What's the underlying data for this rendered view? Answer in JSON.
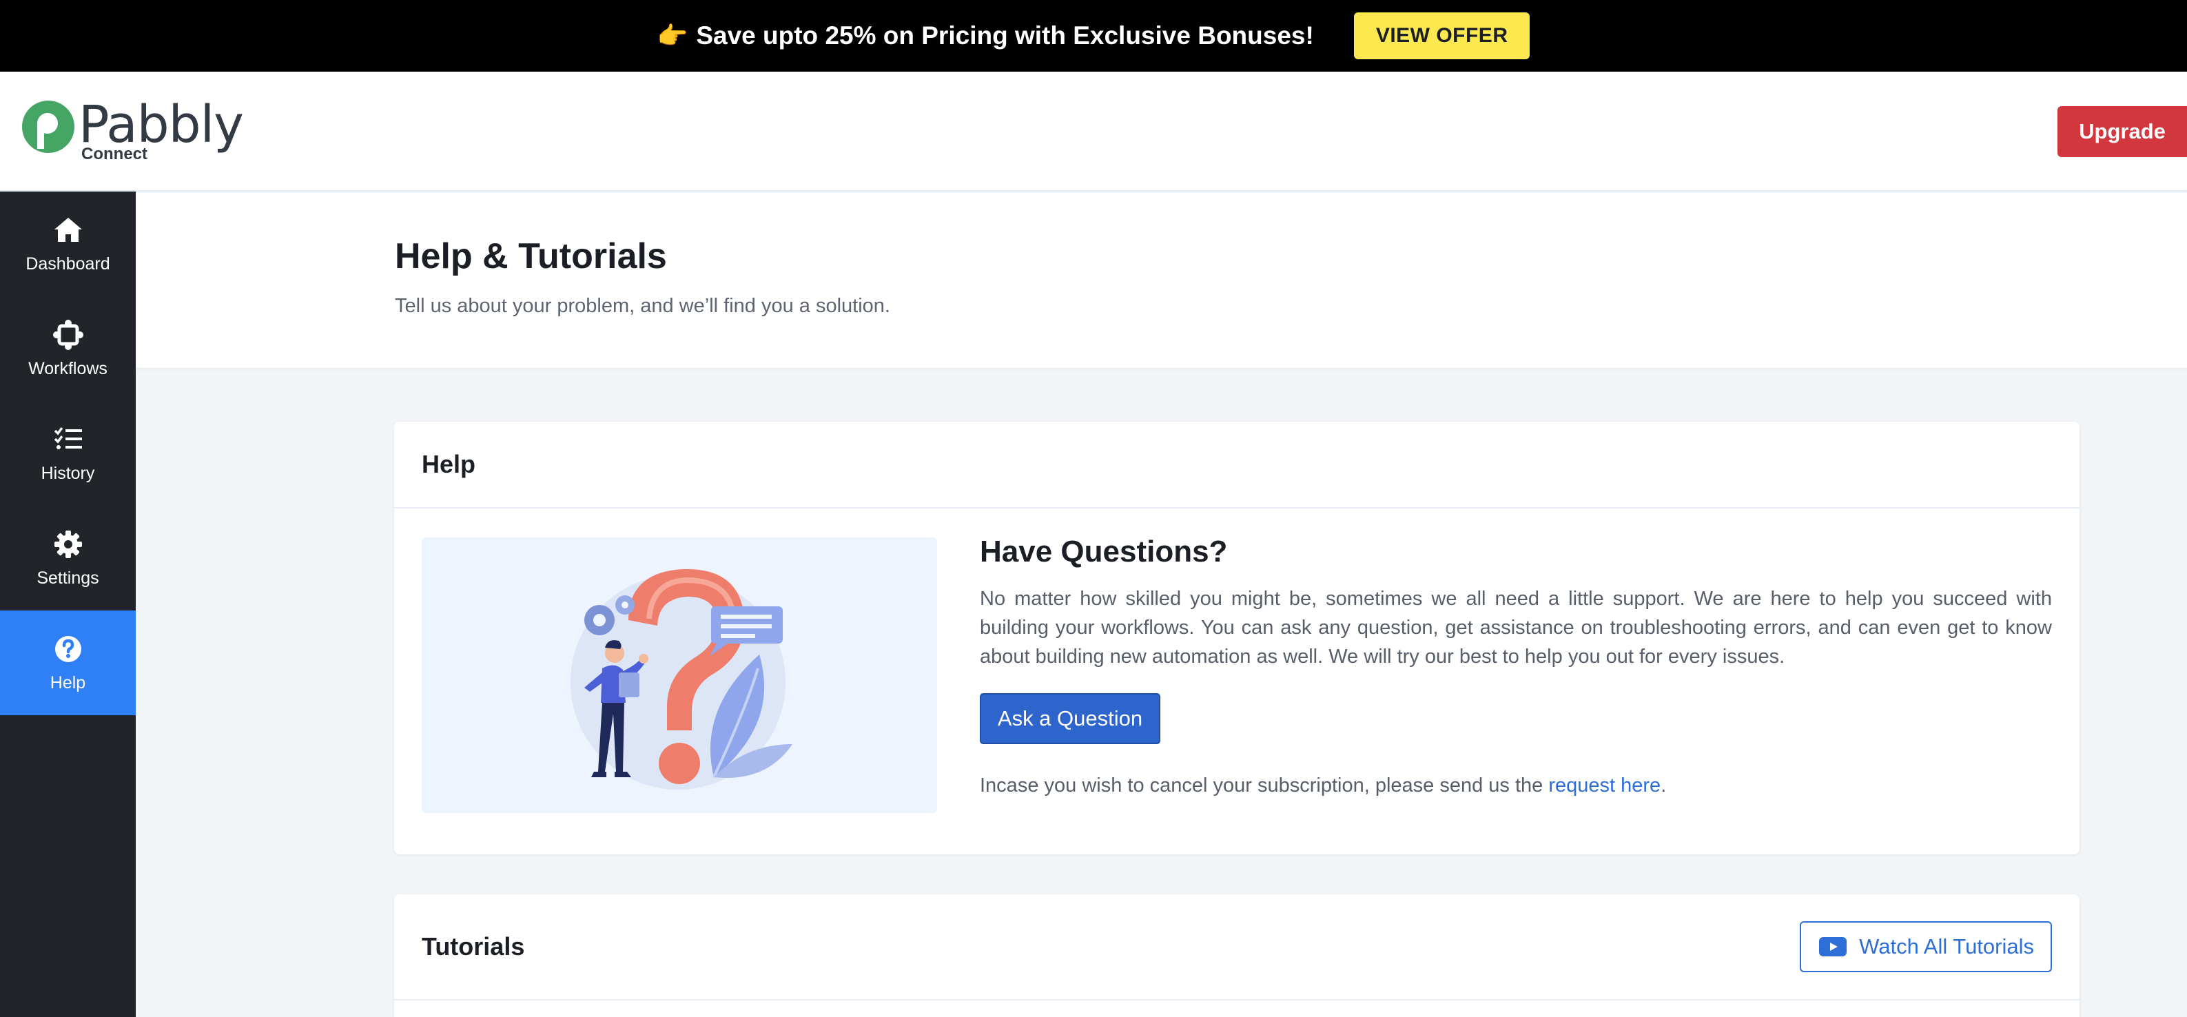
{
  "promo": {
    "emoji": "👉",
    "text": "Save upto 25% on Pricing with Exclusive Bonuses!",
    "button": "VIEW OFFER"
  },
  "header": {
    "logo_word": "Pabbly",
    "logo_sub": "Connect",
    "upgrade": "Upgrade"
  },
  "sidebar": {
    "items": [
      {
        "label": "Dashboard",
        "icon": "home-icon"
      },
      {
        "label": "Workflows",
        "icon": "workflow-icon"
      },
      {
        "label": "History",
        "icon": "checklist-icon"
      },
      {
        "label": "Settings",
        "icon": "gear-icon"
      },
      {
        "label": "Help",
        "icon": "question-circle-icon",
        "active": true
      }
    ]
  },
  "page": {
    "title": "Help & Tutorials",
    "subtitle": "Tell us about your problem, and we’ll find you a solution."
  },
  "help_card": {
    "heading": "Help",
    "title": "Have Questions?",
    "body": "No matter how skilled you might be, sometimes we all need a little support. We are here to help you succeed with building your workflows. You can ask any question, get assistance on troubleshooting errors, and can even get to know about building new automation as well. We will try our best to help you out for every issues.",
    "ask_button": "Ask a Question",
    "cancel_text": "Incase you wish to cancel your subscription, please send us the ",
    "cancel_link": "request here",
    "cancel_end": "."
  },
  "tutorials_card": {
    "heading": "Tutorials",
    "watch_button": "Watch All Tutorials"
  },
  "colors": {
    "sidebar": "#212529",
    "active": "#2f80f6",
    "upgrade": "#d1373d",
    "primary": "#2d65cc",
    "promo_button": "#fce94f"
  }
}
